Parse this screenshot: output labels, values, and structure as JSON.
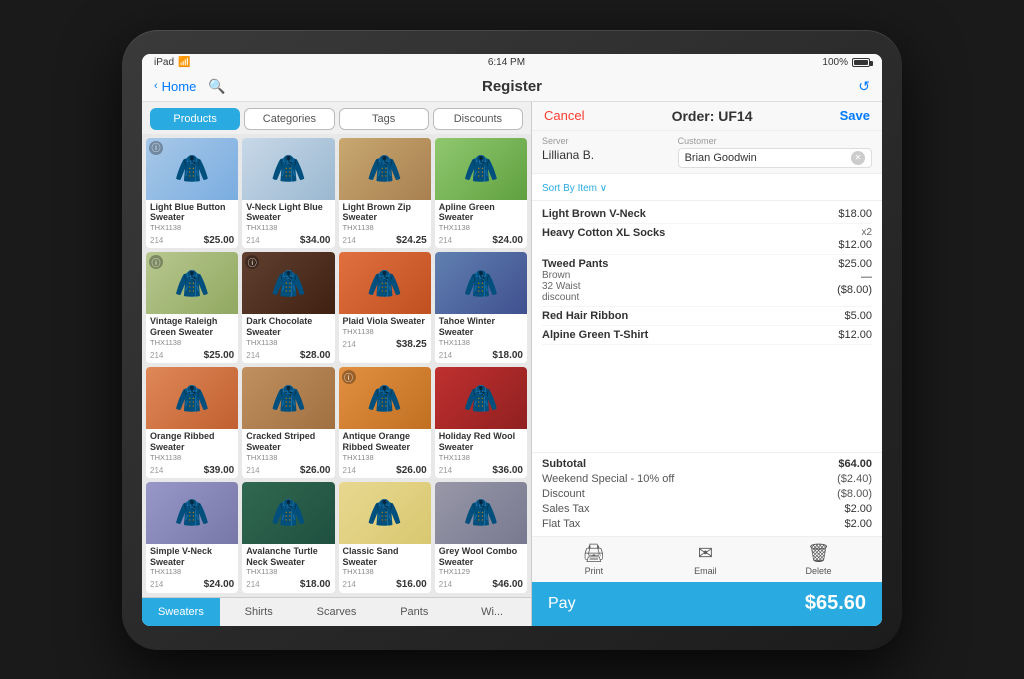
{
  "device": {
    "status_bar": {
      "left": "iPad",
      "wifi": "wifi",
      "time": "6:14 PM",
      "battery": "100%"
    }
  },
  "nav": {
    "back_label": "Home",
    "title": "Register",
    "cancel_label": "Cancel",
    "order_label": "Order: UF14",
    "save_label": "Save"
  },
  "tabs": [
    {
      "id": "products",
      "label": "Products",
      "active": true
    },
    {
      "id": "categories",
      "label": "Categories",
      "active": false
    },
    {
      "id": "tags",
      "label": "Tags",
      "active": false
    },
    {
      "id": "discounts",
      "label": "Discounts",
      "active": false
    }
  ],
  "products": [
    {
      "name": "Light Blue Button Sweater",
      "sku": "THX1138",
      "stock": "214",
      "price": "$25.00",
      "color": "sw-lb"
    },
    {
      "name": "V-Neck Light Blue Sweater",
      "sku": "THX1138",
      "stock": "214",
      "price": "$34.00",
      "color": "sw-vn"
    },
    {
      "name": "Light Brown Zip Sweater",
      "sku": "THX1138",
      "stock": "214",
      "price": "$24.25",
      "color": "sw-lb2"
    },
    {
      "name": "Apline Green Sweater",
      "sku": "THX1138",
      "stock": "214",
      "price": "$24.00",
      "color": "sw-ag"
    },
    {
      "name": "Vintage Raleigh Green Sweater",
      "sku": "THX1138",
      "stock": "214",
      "price": "$25.00",
      "color": "sw-vr"
    },
    {
      "name": "Dark Chocolate Sweater",
      "sku": "THX1138",
      "stock": "214",
      "price": "$28.00",
      "color": "sw-dc"
    },
    {
      "name": "Plaid Viola Sweater",
      "sku": "THX1138",
      "stock": "214",
      "price": "$38.25",
      "color": "sw-pv"
    },
    {
      "name": "Tahoe Winter Sweater",
      "sku": "THX1138",
      "stock": "214",
      "price": "$18.00",
      "color": "sw-tw"
    },
    {
      "name": "Orange Ribbed Sweater",
      "sku": "THX1138",
      "stock": "214",
      "price": "$39.00",
      "color": "sw-or"
    },
    {
      "name": "Cracked Striped Sweater",
      "sku": "THX1138",
      "stock": "214",
      "price": "$26.00",
      "color": "sw-cs"
    },
    {
      "name": "Antique Orange Ribbed Sweater",
      "sku": "THX1138",
      "stock": "214",
      "price": "$26.00",
      "color": "sw-ao"
    },
    {
      "name": "Holiday Red Wool Sweater",
      "sku": "THX1138",
      "stock": "214",
      "price": "$36.00",
      "color": "sw-hr"
    },
    {
      "name": "Simple V-Neck Sweater",
      "sku": "THX1138",
      "stock": "214",
      "price": "$24.00",
      "color": "sw-sv"
    },
    {
      "name": "Avalanche Turtle Neck Sweater",
      "sku": "THX1138",
      "stock": "214",
      "price": "$18.00",
      "color": "sw-at"
    },
    {
      "name": "Classic Sand Sweater",
      "sku": "THX1138",
      "stock": "214",
      "price": "$16.00",
      "color": "sw-csa"
    },
    {
      "name": "Grey Wool Combo Sweater",
      "sku": "THX1129",
      "stock": "214",
      "price": "$46.00",
      "color": "sw-gw"
    }
  ],
  "category_tabs": [
    {
      "id": "sweaters",
      "label": "Sweaters",
      "active": true
    },
    {
      "id": "shirts",
      "label": "Shirts",
      "active": false
    },
    {
      "id": "scarves",
      "label": "Scarves",
      "active": false
    },
    {
      "id": "pants",
      "label": "Pants",
      "active": false
    },
    {
      "id": "wi",
      "label": "Wi...",
      "active": false
    }
  ],
  "order": {
    "server_label": "Server",
    "server_name": "Lilliana B.",
    "customer_label": "Customer",
    "customer_name": "Brian Goodwin",
    "sort_by": "Sort By Item ∨",
    "items": [
      {
        "name": "Light Brown V-Neck",
        "sub": "",
        "qty": "",
        "price": "$18.00"
      },
      {
        "name": "Heavy Cotton XL Socks",
        "sub": "",
        "qty": "x2",
        "price": "$12.00"
      },
      {
        "name": "Tweed Pants",
        "sub": "Brown\n32 Waist\ndiscount",
        "qty": "",
        "prices": [
          "$25.00",
          "—",
          "($8.00)"
        ]
      },
      {
        "name": "Red Hair Ribbon",
        "sub": "",
        "qty": "",
        "price": "$5.00"
      },
      {
        "name": "Alpine Green T-Shirt",
        "sub": "",
        "qty": "",
        "price": "$12.00"
      }
    ],
    "subtotal_label": "Subtotal",
    "subtotal_value": "$64.00",
    "discount1_label": "Weekend Special - 10% off",
    "discount1_value": "($2.40)",
    "discount2_label": "Discount",
    "discount2_value": "($8.00)",
    "tax1_label": "Sales Tax",
    "tax1_value": "$2.00",
    "tax2_label": "Flat Tax",
    "tax2_value": "$2.00",
    "actions": [
      {
        "id": "print",
        "icon": "🖨",
        "label": "Print"
      },
      {
        "id": "email",
        "icon": "✉",
        "label": "Email"
      },
      {
        "id": "delete",
        "icon": "🗑",
        "label": "Delete"
      }
    ],
    "pay_label": "Pay",
    "pay_amount": "$65.60"
  }
}
